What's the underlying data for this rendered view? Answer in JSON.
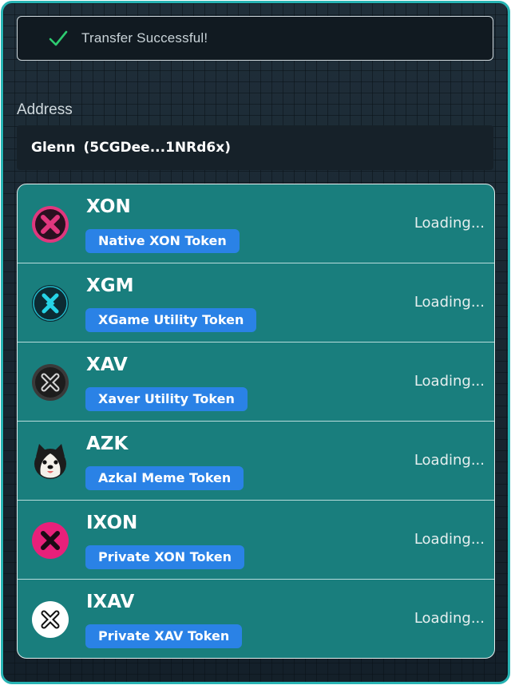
{
  "toast": {
    "icon": "check-icon",
    "message": "Transfer Successful!",
    "accent": "#2ecc71"
  },
  "address": {
    "label": "Address",
    "name": "Glenn",
    "short": "(5CGDee...1NRd6x)"
  },
  "tokens": [
    {
      "symbol": "XON",
      "description": "Native XON Token",
      "balance": "Loading...",
      "icon": "xon-logo-icon"
    },
    {
      "symbol": "XGM",
      "description": "XGame Utility Token",
      "balance": "Loading...",
      "icon": "xgm-logo-icon"
    },
    {
      "symbol": "XAV",
      "description": "Xaver Utility Token",
      "balance": "Loading...",
      "icon": "xav-logo-icon"
    },
    {
      "symbol": "AZK",
      "description": "Azkal Meme Token",
      "balance": "Loading...",
      "icon": "azk-dog-logo-icon"
    },
    {
      "symbol": "IXON",
      "description": "Private XON Token",
      "balance": "Loading...",
      "icon": "ixon-logo-icon"
    },
    {
      "symbol": "IXAV",
      "description": "Private XAV Token",
      "balance": "Loading...",
      "icon": "ixav-logo-icon"
    }
  ],
  "colors": {
    "frame": "#27b3b3",
    "list_bg": "#197e7d",
    "badge": "#2a82e6"
  }
}
